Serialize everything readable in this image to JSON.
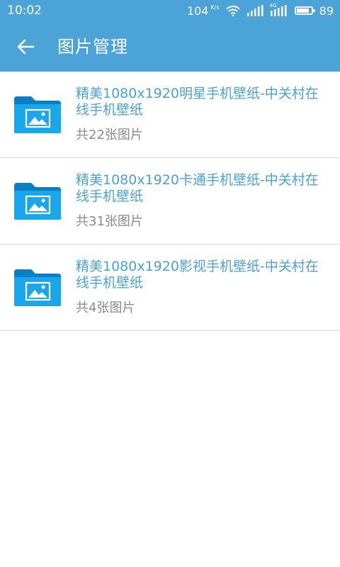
{
  "status_bar": {
    "time": "10:02",
    "net_speed": "104",
    "net_speed_unit": "K/s",
    "mobile_data_label": "4G",
    "battery_level": "89",
    "battery_fraction": 0.89
  },
  "app_bar": {
    "title": "图片管理",
    "back_icon": "arrow-left-icon"
  },
  "albums": [
    {
      "title": "精美1080x1920明星手机壁纸-中关村在线手机壁纸",
      "count": "共22张图片",
      "icon": "image-folder-icon"
    },
    {
      "title": "精美1080x1920卡通手机壁纸-中关村在线手机壁纸",
      "count": "共31张图片",
      "icon": "image-folder-icon"
    },
    {
      "title": "精美1080x1920影视手机壁纸-中关村在线手机壁纸",
      "count": "共4张图片",
      "icon": "image-folder-icon"
    }
  ],
  "colors": {
    "primary": "#4ba3d8",
    "title_text": "#4aa3d6",
    "secondary_text": "#8a8a8a",
    "folder_dark": "#0a7fc4",
    "folder_light": "#19a6ea",
    "divider": "#d9d9d9"
  }
}
